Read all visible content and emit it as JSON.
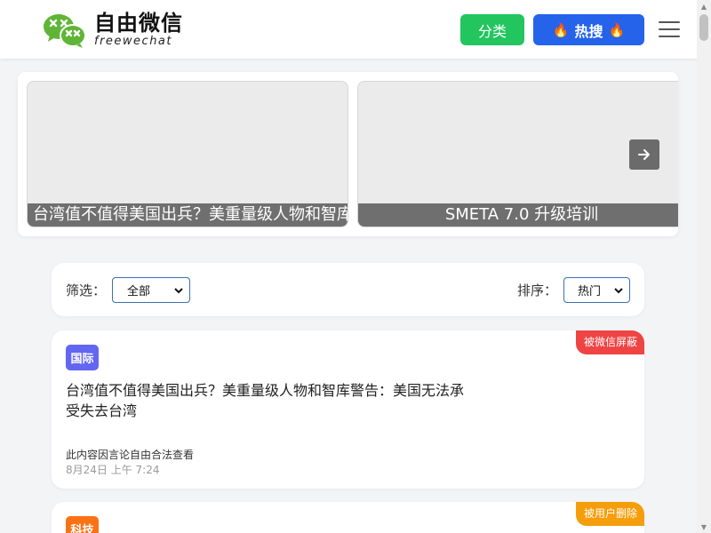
{
  "header": {
    "brand_cn": "自由微信",
    "brand_en": "freewechat",
    "category_button": "分类",
    "hot_search_button": "热搜"
  },
  "carousel": {
    "slides": [
      {
        "caption": "台湾值不值得美国出兵？美重量级人物和智库警告：美国无法承受失去台湾"
      },
      {
        "caption": "SMETA 7.0 升级培训"
      }
    ]
  },
  "filter": {
    "label": "筛选：",
    "selected": "全部",
    "sort_label": "排序：",
    "sort_selected": "热门"
  },
  "articles": [
    {
      "category": "国际",
      "status": "被微信屏蔽",
      "title": "台湾值不值得美国出兵？美重量级人物和智库警告：美国无法承受失去台湾",
      "note": "此内容因言论自由合法查看",
      "time": "8月24日 上午 7:24"
    },
    {
      "category": "科技",
      "status": "被用户删除"
    }
  ],
  "colors": {
    "category_button": "#22c55e",
    "hot_search_button": "#2563eb",
    "badge_blocked": "#ef4444",
    "badge_deleted": "#f59e0b",
    "category_intl": "#6366f1",
    "category_tech": "#f97316",
    "logo_green": "#5fb536"
  },
  "icons": [
    "wechat-logo-icon",
    "flame-icon",
    "menu-icon",
    "arrow-right-icon",
    "chevron-down-icon"
  ]
}
